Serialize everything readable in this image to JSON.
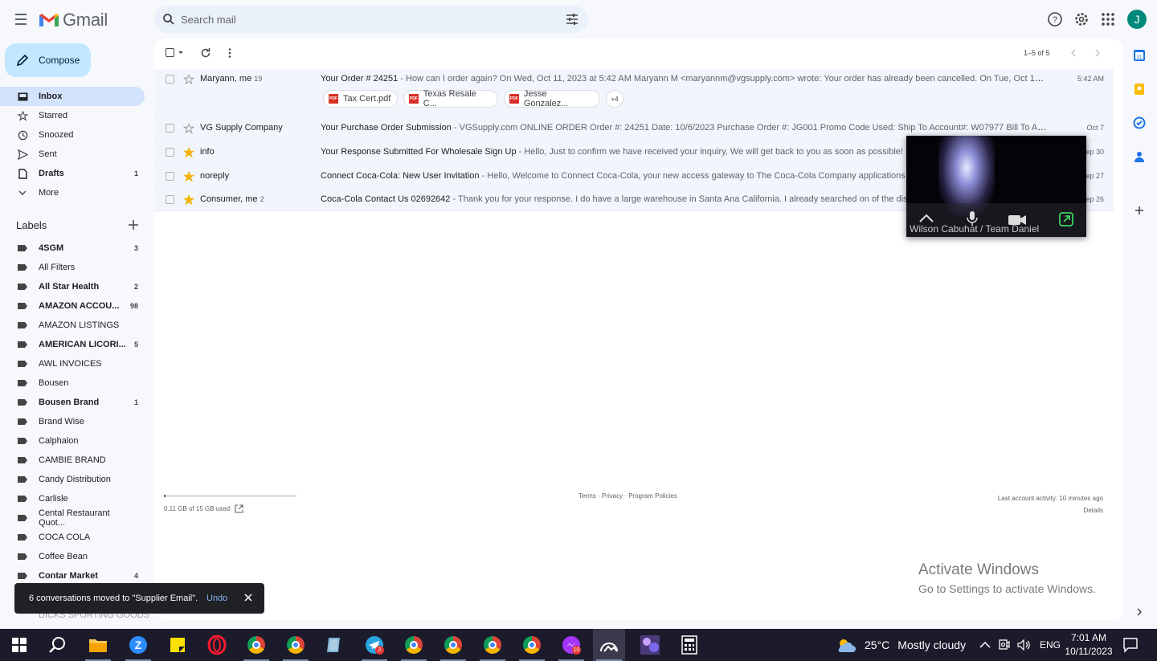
{
  "app": {
    "name": "Gmail",
    "avatar_letter": "J"
  },
  "search": {
    "placeholder": "Search mail"
  },
  "compose_label": "Compose",
  "nav": [
    {
      "label": "Inbox",
      "count": "",
      "icon": "inbox-icon",
      "active": true
    },
    {
      "label": "Starred",
      "count": "",
      "icon": "star-icon"
    },
    {
      "label": "Snoozed",
      "count": "",
      "icon": "clock-icon"
    },
    {
      "label": "Sent",
      "count": "",
      "icon": "send-icon"
    },
    {
      "label": "Drafts",
      "count": "1",
      "icon": "draft-icon"
    },
    {
      "label": "More",
      "count": "",
      "icon": "chevron-down-icon"
    }
  ],
  "labels_heading": "Labels",
  "labels": [
    {
      "label": "4SGM",
      "count": "3",
      "bold": true
    },
    {
      "label": "All Filters",
      "count": ""
    },
    {
      "label": "All Star Health",
      "count": "2",
      "bold": true
    },
    {
      "label": "AMAZON ACCOU...",
      "count": "98",
      "bold": true
    },
    {
      "label": "AMAZON LISTINGS",
      "count": ""
    },
    {
      "label": "AMERICAN LICORI...",
      "count": "5",
      "bold": true
    },
    {
      "label": "AWL INVOICES",
      "count": ""
    },
    {
      "label": "Bousen",
      "count": ""
    },
    {
      "label": "Bousen Brand",
      "count": "1",
      "bold": true
    },
    {
      "label": "Brand Wise",
      "count": ""
    },
    {
      "label": "Calphalon",
      "count": ""
    },
    {
      "label": "CAMBIE BRAND",
      "count": ""
    },
    {
      "label": "Candy Distribution",
      "count": ""
    },
    {
      "label": "Carlisle",
      "count": ""
    },
    {
      "label": "Cental Restaurant Quot...",
      "count": ""
    },
    {
      "label": "COCA COLA",
      "count": ""
    },
    {
      "label": "Coffee Bean",
      "count": ""
    },
    {
      "label": "Contar Market",
      "count": "4",
      "bold": true
    }
  ],
  "hidden_label": "DICKS SPORTING GOODS",
  "pager": "1–5 of 5",
  "emails": [
    {
      "sender": "Maryann, me",
      "sender_count": "19",
      "starred": false,
      "subject": "Your Order # 24251",
      "preview": " - How can I order again? On Wed, Oct 11, 2023 at 5:42 AM Maryann M <maryannm@vgsupply.com> wrote: Your order has already been cancelled. On Tue, Oct 10, 2023 at ...",
      "date": "5:42 AM",
      "attachments": [
        "Tax Cert.pdf",
        "Texas Resale C...",
        "Jesse Gonzalez..."
      ],
      "more_attachments": "+4"
    },
    {
      "sender": "VG Supply Company",
      "sender_count": "",
      "starred": false,
      "subject": "Your Purchase Order Submission",
      "preview": " - VGSupply.com ONLINE ORDER Order #: 24251 Date: 10/6/2023 Purchase Order #: JG001 Promo Code Used: Ship To Account#: W07977 Bill To Account#: ...",
      "date": "Oct 7"
    },
    {
      "sender": "info",
      "sender_count": "",
      "starred": true,
      "subject": "Your Response Submitted For Wholesale Sign Up",
      "preview": " - Hello, Just to confirm we have received your inquiry, We will get back to you as soon as possible!",
      "date": "Sep 30"
    },
    {
      "sender": "noreply",
      "sender_count": "",
      "starred": true,
      "subject": "Connect Coca-Cola: New User Invitation",
      "preview": " - Hello, Welcome to Connect Coca-Cola, your new access gateway to The Coca-Cola Company applications you",
      "date": "Sep 27"
    },
    {
      "sender": "Consumer, me",
      "sender_count": "2",
      "starred": true,
      "subject": "Coca-Cola Contact Us 02692642",
      "preview": " - Thank you for your response. I do have a large warehouse in Santa Ana California. I already searched on of the distribu",
      "date": "Sep 26"
    }
  ],
  "footer": {
    "storage": "0.11 GB of 15 GB used",
    "storage_fraction": 0.007,
    "terms": "Terms · Privacy · Program Policies",
    "activity": "Last account activity: 10 minutes ago",
    "details": "Details"
  },
  "video_overlay": {
    "name": "Wilson Cabuhat / Team Daniel"
  },
  "snackbar": {
    "message": "6 conversations moved to \"Supplier Email\".",
    "undo": "Undo"
  },
  "activate_windows": {
    "title": "Activate Windows",
    "subtitle": "Go to Settings to activate Windows."
  },
  "taskbar": {
    "badges": [
      "2",
      "10"
    ],
    "weather": {
      "temp": "25°C",
      "condition": "Mostly cloudy"
    },
    "language": "ENG",
    "time": "7:01 AM",
    "date": "10/11/2023"
  },
  "colors": {
    "accent": "#0b57d0",
    "compose_bg": "#c2e7ff",
    "active_nav": "#d3e3fd",
    "star": "#f4b400"
  }
}
